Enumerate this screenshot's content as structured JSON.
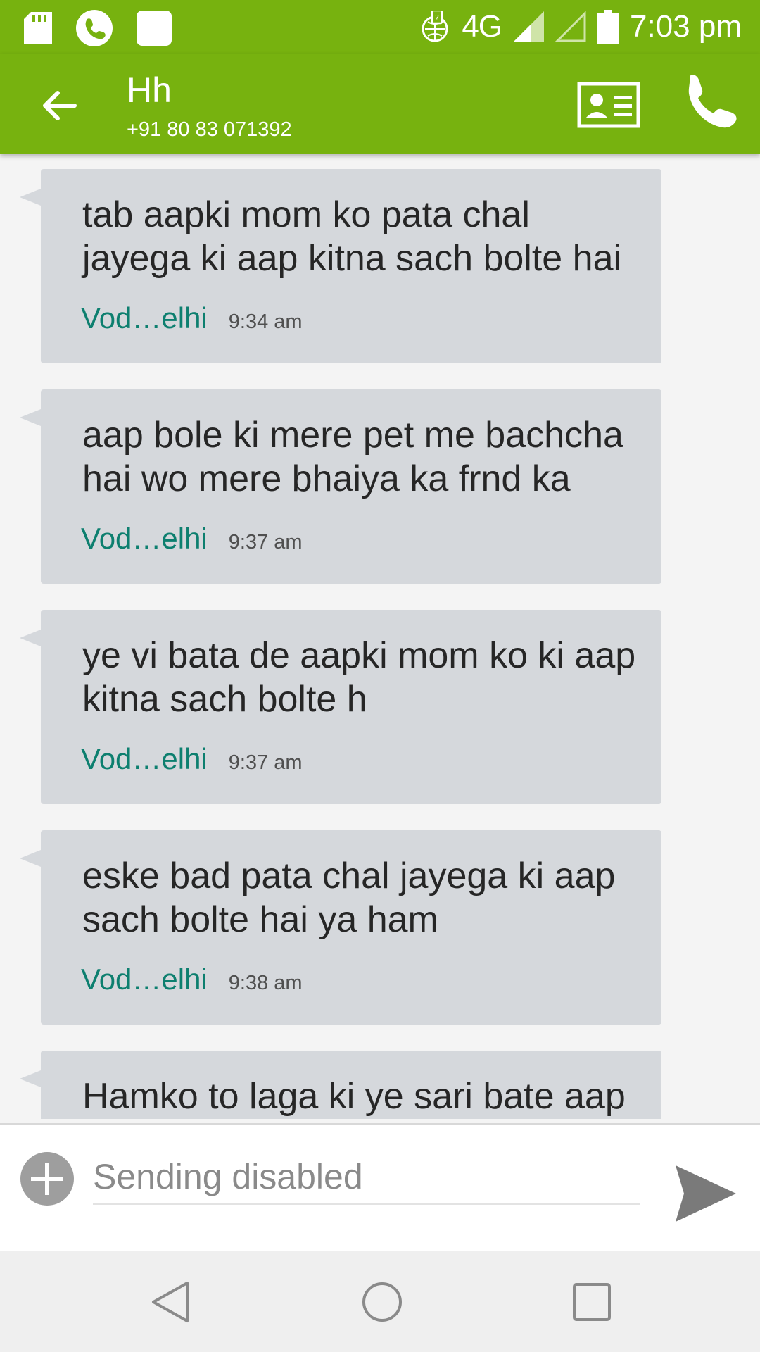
{
  "status_bar": {
    "network": "4G",
    "time": "7:03 pm",
    "icons": [
      "sd-card-icon",
      "phone-icon",
      "app-icon",
      "data-saver-icon",
      "signal-icon",
      "signal-empty-icon",
      "battery-icon"
    ]
  },
  "app_bar": {
    "contact_name": "Hh",
    "contact_phone": "+91 80 83 071392",
    "icons": [
      "back-arrow-icon",
      "contact-card-icon",
      "call-icon"
    ]
  },
  "messages": [
    {
      "text": "tab aapki mom ko pata chal jayega ki aap kitna sach bolte hai",
      "carrier": "Vod…elhi",
      "time": "9:34 am"
    },
    {
      "text": "aap bole ki mere pet me bachcha hai wo mere bhaiya ka frnd ka",
      "carrier": "Vod…elhi",
      "time": "9:37 am"
    },
    {
      "text": "ye vi bata de aapki mom ko ki aap kitna sach bolte h",
      "carrier": "Vod…elhi",
      "time": "9:37 am"
    },
    {
      "text": "eske bad pata chal jayega ki aap sach bolte hai ya ham",
      "carrier": "Vod…elhi",
      "time": "9:38 am"
    },
    {
      "text": "Hamko to laga ki ye sari bate aap"
    }
  ],
  "composer": {
    "placeholder": "Sending disabled",
    "icons": [
      "add-icon",
      "send-icon"
    ]
  },
  "colors": {
    "accent": "#77b20f",
    "bubble": "#d5d8dc",
    "carrier_text": "#0d7f6f"
  }
}
